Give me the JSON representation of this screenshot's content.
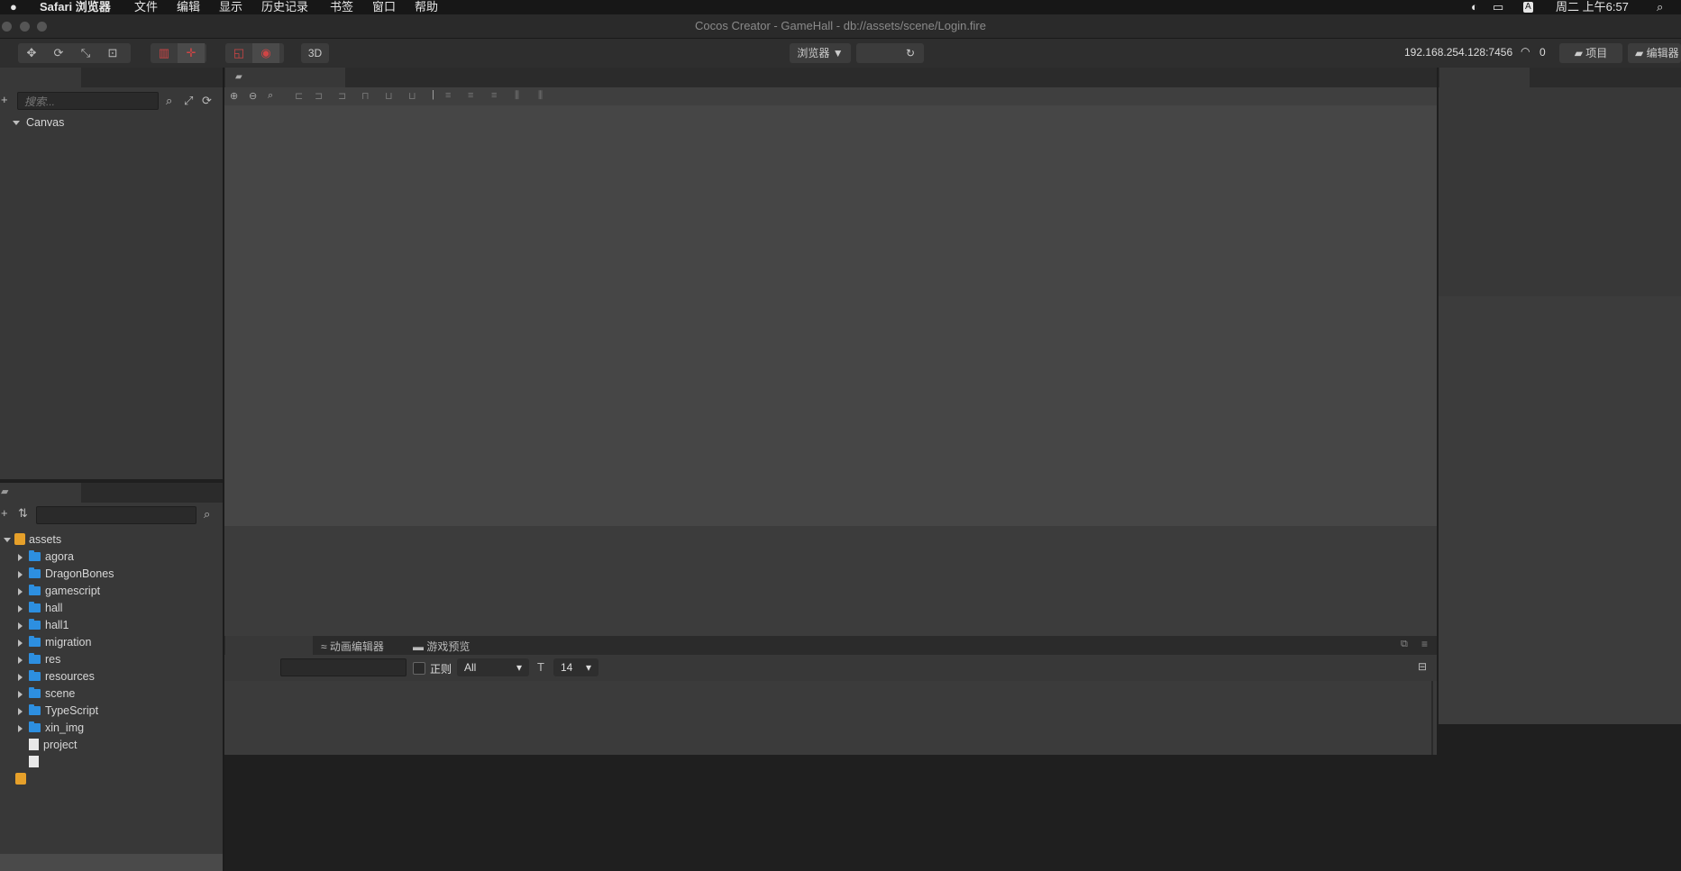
{
  "menubar": {
    "apple": "",
    "app": "Safari 浏览器",
    "items": [
      "文件",
      "编辑",
      "显示",
      "历史记录",
      "书签",
      "窗口",
      "帮助"
    ],
    "clock": "周二 上午6:57",
    "input_method": "A"
  },
  "window": {
    "title": "Cocos Creator - GameHall - db://assets/scene/Login.fire"
  },
  "toolbar": {
    "mode_3d": "3D",
    "preview_target": "浏览器 ▼",
    "refresh": "↻",
    "ip": "192.168.254.128:7456",
    "connections": "0",
    "project_button": "项目",
    "editor_button": "编辑器"
  },
  "hierarchy": {
    "search_placeholder": "搜索...",
    "root": "Canvas"
  },
  "assets": {
    "root": "assets",
    "folders": [
      "agora",
      "DragonBones",
      "gamescript",
      "hall",
      "hall1",
      "migration",
      "res",
      "resources",
      "scene",
      "TypeScript",
      "xin_img"
    ],
    "files": [
      "project"
    ]
  },
  "console": {
    "tab_animation": "动画编辑器",
    "tab_preview": "游戏预览",
    "regex_label": "正则",
    "level": "All",
    "font_size": "14"
  }
}
